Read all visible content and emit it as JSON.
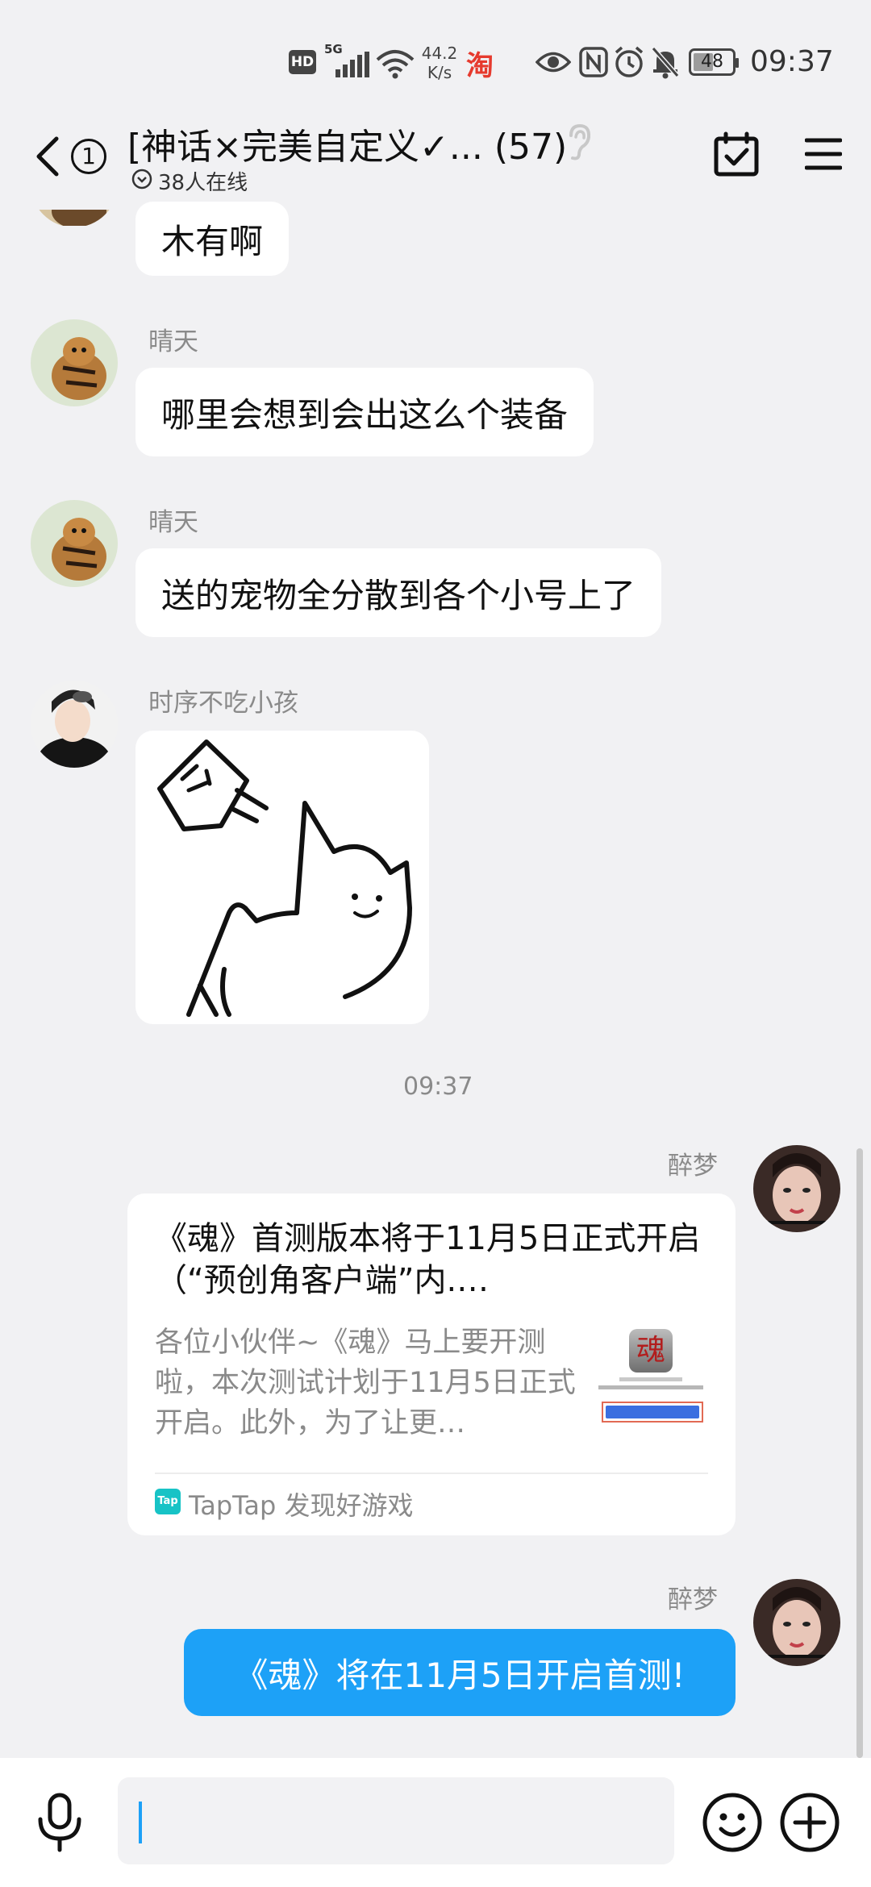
{
  "status_bar": {
    "net_speed_value": "44.2",
    "net_speed_unit": "K/s",
    "hd_label": "HD",
    "signal_label": "5G",
    "battery": "48",
    "time": "09:37",
    "taobao_glyph": "淘"
  },
  "header": {
    "unread_count": "1",
    "title": "[神话×完美自定义✓... (57)",
    "online": "38人在线"
  },
  "messages": [
    {
      "sender": "",
      "text": "木有啊"
    },
    {
      "sender": "晴天",
      "text": "哪里会想到会出这么个装备"
    },
    {
      "sender": "晴天",
      "text": "送的宠物全分散到各个小号上了"
    },
    {
      "sender": "时序不吃小孩",
      "sticker": "cat-sticker"
    }
  ],
  "timestamp": "09:37",
  "outgoing": {
    "sender_1": "醉梦",
    "card": {
      "title": "《魂》首测版本将于11月5日正式开启（“预创角客户端”内.…",
      "desc": "各位小伙伴~《魂》马上要开测啦，本次测试计划于11月5日正式开启。此外，为了让更…",
      "thumb_glyph": "魂",
      "source_badge": "Tap",
      "source": "TapTap 发现好游戏"
    },
    "sender_2": "醉梦",
    "text": "《魂》将在11月5日开启首测!"
  },
  "colors": {
    "accent": "#1da1f7",
    "background": "#f1f1f3",
    "tap_badge": "#17c3c6"
  },
  "icons": [
    "back-icon",
    "calendar-check-icon",
    "menu-icon",
    "ear-icon",
    "mic-icon",
    "emoji-icon",
    "plus-icon"
  ]
}
